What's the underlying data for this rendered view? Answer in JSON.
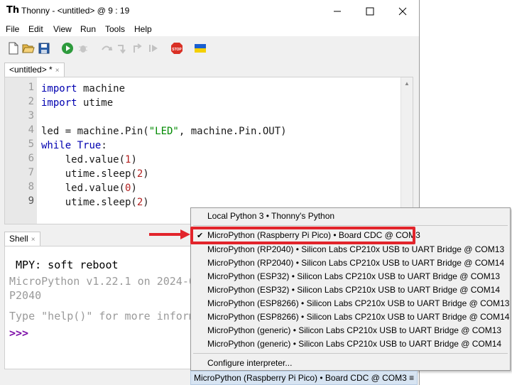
{
  "window": {
    "title": "Thonny  -  <untitled>  @  9 : 19",
    "app_icon_glyph": "Th"
  },
  "menu": [
    "File",
    "Edit",
    "View",
    "Run",
    "Tools",
    "Help"
  ],
  "toolbar": {
    "icons": [
      "new-file-icon",
      "open-file-icon",
      "save-icon",
      "run-icon",
      "debug-icon",
      "step-over-icon",
      "step-into-icon",
      "step-out-icon",
      "resume-icon",
      "stop-icon",
      "ukraine-flag-icon"
    ],
    "stop_label": "STOP",
    "accent_run": "#2e9b3d",
    "accent_stop": "#d93025"
  },
  "editor": {
    "tab_label": "<untitled> *",
    "tab_close": "×",
    "line_numbers": [
      "1",
      "2",
      "3",
      "4",
      "5",
      "6",
      "7",
      "8",
      "9"
    ],
    "lines": [
      {
        "parts": [
          {
            "t": "import",
            "c": "kw"
          },
          {
            "t": " machine",
            "c": ""
          }
        ]
      },
      {
        "parts": [
          {
            "t": "import",
            "c": "kw"
          },
          {
            "t": " utime",
            "c": ""
          }
        ]
      },
      {
        "parts": []
      },
      {
        "parts": [
          {
            "t": "led = machine.Pin(",
            "c": ""
          },
          {
            "t": "\"LED\"",
            "c": "str"
          },
          {
            "t": ", machine.Pin.OUT)",
            "c": ""
          }
        ]
      },
      {
        "parts": [
          {
            "t": "while",
            "c": "kw"
          },
          {
            "t": " ",
            "c": ""
          },
          {
            "t": "True",
            "c": "kw"
          },
          {
            "t": ":",
            "c": ""
          }
        ]
      },
      {
        "parts": [
          {
            "t": "    led.value(",
            "c": ""
          },
          {
            "t": "1",
            "c": "num"
          },
          {
            "t": ")",
            "c": ""
          }
        ]
      },
      {
        "parts": [
          {
            "t": "    utime.sleep(",
            "c": ""
          },
          {
            "t": "2",
            "c": "num"
          },
          {
            "t": ")",
            "c": ""
          }
        ]
      },
      {
        "parts": [
          {
            "t": "    led.value(",
            "c": ""
          },
          {
            "t": "0",
            "c": "num"
          },
          {
            "t": ")",
            "c": ""
          }
        ]
      },
      {
        "parts": [
          {
            "t": "    utime.sleep(",
            "c": ""
          },
          {
            "t": "2",
            "c": "num"
          },
          {
            "t": ")",
            "c": ""
          }
        ]
      }
    ]
  },
  "shell": {
    "tab_label": "Shell",
    "tab_close": "×",
    "lines": [
      {
        "text": " MPY: soft reboot",
        "cls": ""
      },
      {
        "text": "MicroPython v1.22.1 on 2024-0",
        "cls": "gray"
      },
      {
        "text": "P2040",
        "cls": "gray"
      },
      {
        "text": "Type \"help()\" for more inform",
        "cls": "gray"
      },
      {
        "text": ">>>",
        "cls": "prompt"
      }
    ]
  },
  "interpreter_menu": {
    "items": [
      {
        "label": "Local Python 3  •  Thonny's Python",
        "checked": false
      },
      {
        "label": "MicroPython (Raspberry Pi Pico)  •  Board CDC @ COM3",
        "checked": true
      },
      {
        "label": "MicroPython (RP2040)  •  Silicon Labs CP210x USB to UART Bridge @ COM13",
        "checked": false
      },
      {
        "label": "MicroPython (RP2040)  •  Silicon Labs CP210x USB to UART Bridge @ COM14",
        "checked": false
      },
      {
        "label": "MicroPython (ESP32)  •  Silicon Labs CP210x USB to UART Bridge @ COM13",
        "checked": false
      },
      {
        "label": "MicroPython (ESP32)  •  Silicon Labs CP210x USB to UART Bridge @ COM14",
        "checked": false
      },
      {
        "label": "MicroPython (ESP8266)  •  Silicon Labs CP210x USB to UART Bridge @ COM13",
        "checked": false
      },
      {
        "label": "MicroPython (ESP8266)  •  Silicon Labs CP210x USB to UART Bridge @ COM14",
        "checked": false
      },
      {
        "label": "MicroPython (generic)  •  Silicon Labs CP210x USB to UART Bridge @ COM13",
        "checked": false
      },
      {
        "label": "MicroPython (generic)  •  Silicon Labs CP210x USB to UART Bridge @ COM14",
        "checked": false
      },
      {
        "label": "Configure interpreter...",
        "checked": false
      }
    ],
    "check_glyph": "✔",
    "highlight_color": "#e2242b"
  },
  "statusbar": {
    "interpreter_label": "MicroPython (Raspberry Pi Pico)  •  Board CDC @ COM3  ≡"
  }
}
